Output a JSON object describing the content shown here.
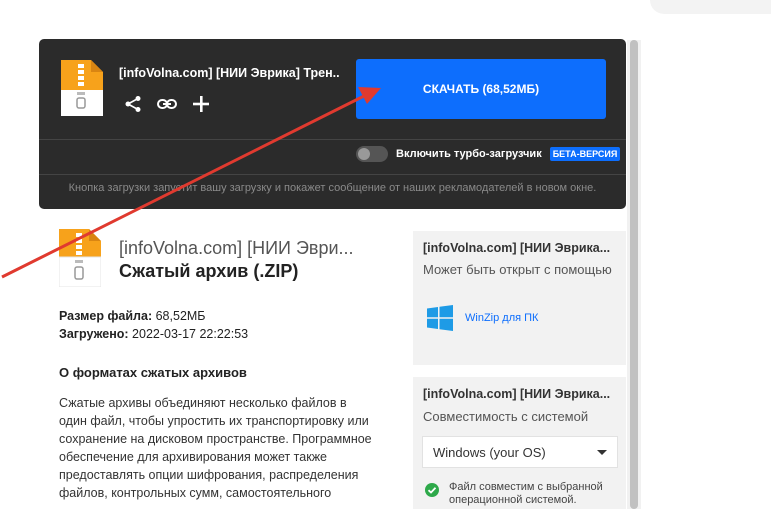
{
  "download_card": {
    "file_title": "[infoVolna.com] [НИИ Эврика] Трен...",
    "download_button": "СКАЧАТЬ (68,52МБ)",
    "turbo_label": "Включить турбо-загрузчик",
    "beta_badge": "БЕТА-ВЕРСИЯ",
    "turbo_enabled": false,
    "notice": "Кнопка загрузки запустит вашу загрузку и покажет сообщение от наших рекламодателей в новом окне."
  },
  "file_info": {
    "name": "[infoVolna.com] [НИИ Эври...",
    "type": "Сжатый архив (.ZIP)",
    "size_label": "Размер файла:",
    "size_value": "68,52МБ",
    "uploaded_label": "Загружено:",
    "uploaded_value": "2022-03-17 22:22:53",
    "about_heading": "О форматах сжатых архивов",
    "about_text": "Сжатые архивы объединяют несколько файлов в один файл, чтобы упростить их транспортировку или сохранение на дисковом пространстве. Программное обеспечение для архивирования может также предоставлять опции шифрования, распределения файлов, контрольных сумм, самостоятельного"
  },
  "open_panel": {
    "title": "[infoVolna.com] [НИИ Эврика...",
    "subtitle": "Может быть открыт с помощью",
    "app": "WinZip для ПК"
  },
  "compat_panel": {
    "title": "[infoVolna.com] [НИИ Эврика...",
    "subtitle": "Совместимость с системой",
    "os_selected": "Windows (your OS)",
    "compat_text": "Файл совместим с выбранной операционной системой."
  },
  "colors": {
    "accent": "#0d6efd",
    "dark_bg": "#2b2b2b",
    "success": "#2ea94a",
    "annotation_arrow": "#e03a2f"
  }
}
